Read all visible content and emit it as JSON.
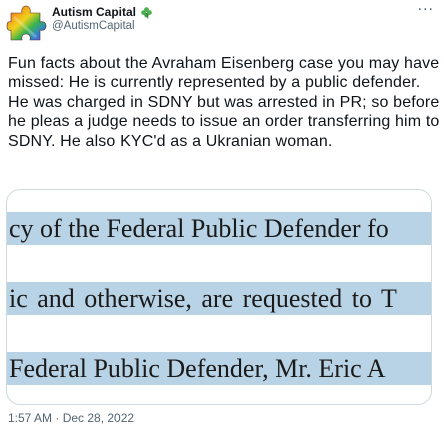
{
  "tweet": {
    "display_name": "Autism Capital",
    "handle": "@AutismCapital",
    "more_label": "···",
    "body": "Fun facts about the Avraham Eisenberg case you may have missed: He is currently represented by a public defender. He was charged in SDNY but was arrested in PR; so before he pleas a judge needs to issue an order transferring him to SDNY. He also KYC'd as a Ukranian woman.",
    "timestamp": "1:57 AM · Dec 28, 2022"
  },
  "media": {
    "lines": [
      "cy of the Federal Public Defender fo",
      "ic and otherwise, are requested to T",
      "Federal Public Defender, Mr. Eric A"
    ],
    "highlight_color": "#b9d3e6"
  },
  "icons": {
    "avatar": "rainbow-puzzle-piece-icon",
    "badge": "shamrock-icon",
    "more": "more-options-icon"
  }
}
